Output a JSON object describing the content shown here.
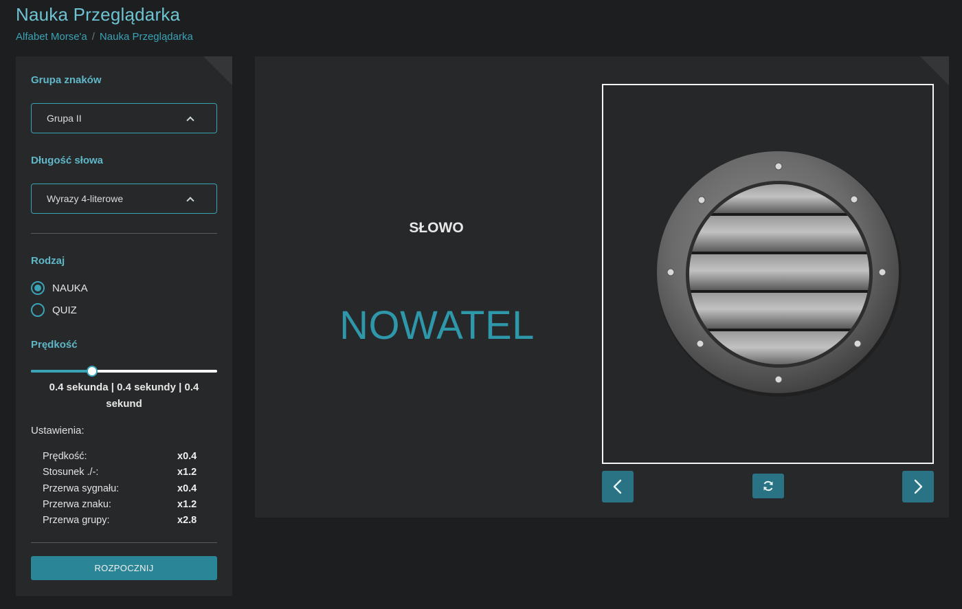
{
  "header": {
    "title": "Nauka Przeglądarka",
    "breadcrumb": {
      "root": "Alfabet Morse'a",
      "separator": "/",
      "current": "Nauka Przeglądarka"
    }
  },
  "sidebar": {
    "group_label": "Grupa znaków",
    "group_value": "Grupa II",
    "length_label": "Długość słowa",
    "length_value": "Wyrazy 4-literowe",
    "mode_label": "Rodzaj",
    "modes": [
      {
        "label": "NAUKA",
        "checked": true
      },
      {
        "label": "QUIZ",
        "checked": false
      }
    ],
    "speed_label": "Prędkość",
    "speed_slider_value": 0.33,
    "speed_text": "0.4 sekunda | 0.4 sekundy | 0.4 sekund",
    "settings_label": "Ustawienia:",
    "settings": [
      {
        "key": "Prędkość:",
        "value": "x0.4"
      },
      {
        "key": "Stosunek ./-:",
        "value": "x1.2"
      },
      {
        "key": "Przerwa sygnału:",
        "value": "x0.4"
      },
      {
        "key": "Przerwa znaku:",
        "value": "x1.2"
      },
      {
        "key": "Przerwa grupy:",
        "value": "x2.8"
      }
    ],
    "start_button": "ROZPOCZNIJ"
  },
  "main": {
    "word_label": "SŁOWO",
    "word_value": "NOWATEL",
    "image_subject": "metal vent grille with screws",
    "prev_icon": "chevron-left-icon",
    "refresh_icon": "refresh-icon",
    "next_icon": "chevron-right-icon"
  },
  "colors": {
    "accent": "#3aa3b6",
    "background": "#1d1e1f",
    "panel": "#272829",
    "button": "#2a7385"
  }
}
